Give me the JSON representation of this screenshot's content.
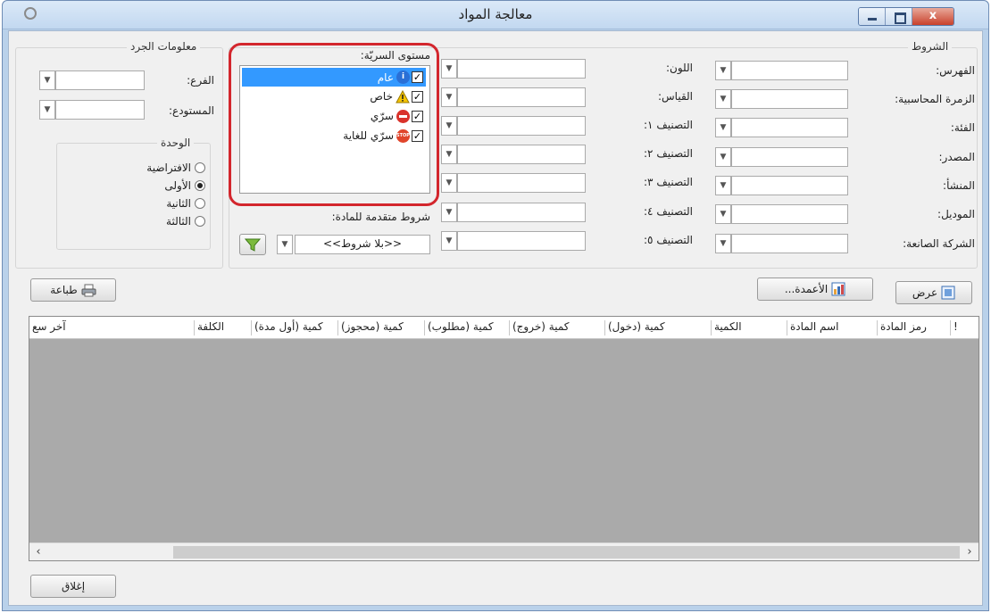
{
  "window": {
    "title": "معالجة المواد",
    "close_glyph": "x"
  },
  "conditions": {
    "title": "الشروط",
    "index_label": "الفهرس:",
    "index_value": "",
    "acc_group_label": "الزمرة المحاسبية:",
    "category_label": "الفئة:",
    "source_label": "المصدر:",
    "origin_label": "المنشأ:",
    "model_label": "الموديل:",
    "manufacturer_label": "الشركة الصانعة:",
    "color_label": "اللون:",
    "size_label": "القياس:",
    "class1_label": "التصنيف ١:",
    "class2_label": "التصنيف ٢:",
    "class3_label": "التصنيف ٣:",
    "class4_label": "التصنيف ٤:",
    "class5_label": "التصنيف ٥:"
  },
  "security": {
    "title": "مستوى السريّة:",
    "items": [
      {
        "label": "عام",
        "icon": "info-icon",
        "checked": true,
        "selected": true
      },
      {
        "label": "خاص",
        "icon": "warning-icon",
        "checked": true,
        "selected": false
      },
      {
        "label": "سرّي",
        "icon": "no-entry-icon",
        "checked": true,
        "selected": false
      },
      {
        "label": "سرّي للغاية",
        "icon": "stop-icon",
        "checked": true,
        "selected": false
      }
    ],
    "stop_text": "STOP",
    "check_glyph": "✓"
  },
  "advanced": {
    "label": "شروط متقدمة للمادة:",
    "value": "<<بلا شروط>>"
  },
  "inventory": {
    "title": "معلومات الجرد",
    "branch_label": "الفرع:",
    "warehouse_label": "المستودع:",
    "unit": {
      "title": "الوحدة",
      "options": [
        {
          "label": "الافتراضية",
          "checked": false
        },
        {
          "label": "الأولى",
          "checked": true
        },
        {
          "label": "الثانية",
          "checked": false
        },
        {
          "label": "الثالثة",
          "checked": false
        }
      ]
    }
  },
  "buttons": {
    "show": "عرض",
    "columns": "الأعمدة...",
    "print": "طباعة",
    "close": "إغلاق"
  },
  "grid": {
    "columns": [
      "!",
      "رمز المادة",
      "اسم المادة",
      "الكمية",
      "كمية (دخول)",
      "كمية (خروج)",
      "كمية (مطلوب)",
      "كمية (محجوز)",
      "كمية (أول مدة)",
      "الكلفة",
      "آخر سع"
    ],
    "rows": []
  }
}
